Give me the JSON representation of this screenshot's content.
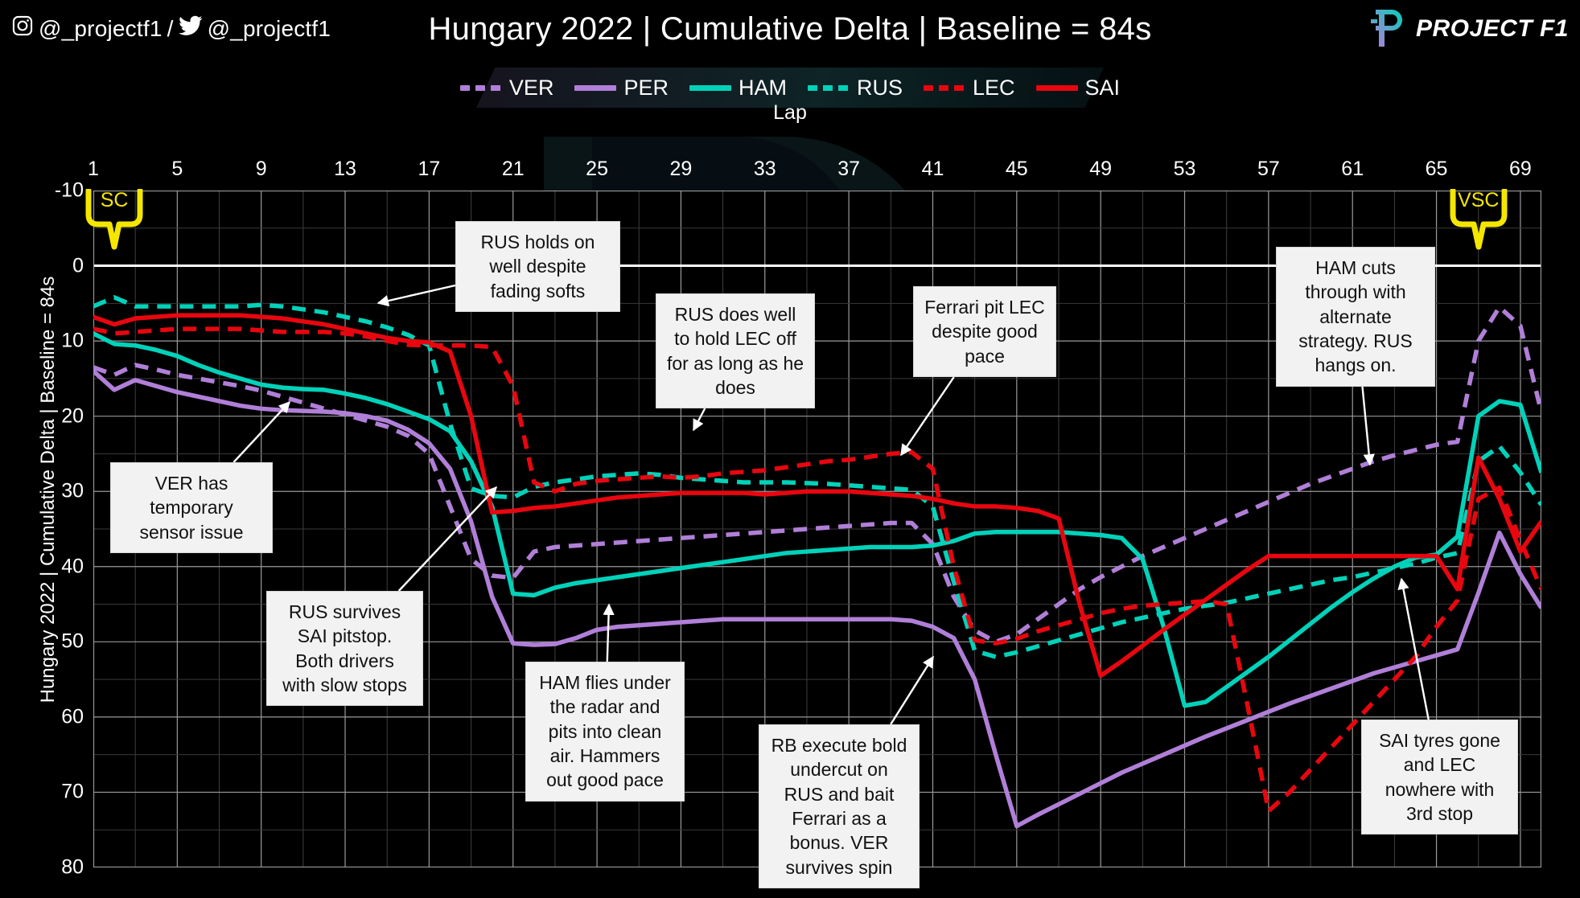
{
  "header": {
    "social_text": "@_projectf1 / @_projectf1",
    "instagram_handle": "@_projectf1",
    "twitter_handle": "@_projectf1",
    "title": "Hungary 2022 | Cumulative Delta | Baseline = 84s",
    "brand_name": "PROJECT F1",
    "instagram_icon": "instagram-icon",
    "twitter_icon": "twitter-icon",
    "logo_icon": "project-f1-logo-icon"
  },
  "chart_data": {
    "type": "line",
    "title": "Hungary 2022 | Cumulative Delta | Baseline = 84s",
    "xlabel": "Lap",
    "ylabel": "Hungary 2022 | Cumulative Delta | Baseline = 84s",
    "xlim": [
      1,
      70
    ],
    "ylim": [
      -10,
      80
    ],
    "y_inverted": true,
    "grid": true,
    "x_ticks": [
      1,
      5,
      9,
      13,
      17,
      21,
      25,
      29,
      33,
      37,
      41,
      45,
      49,
      53,
      57,
      61,
      65,
      69
    ],
    "y_ticks": [
      -10,
      0,
      10,
      20,
      30,
      40,
      50,
      60,
      70,
      80
    ],
    "legend_position": "top-center",
    "colors": {
      "VER": "#b07fd8",
      "PER": "#b07fd8",
      "HAM": "#00d2ba",
      "RUS": "#00d2ba",
      "LEC": "#e8060f",
      "SAI": "#e8060f",
      "background": "#000000",
      "text": "#ffffff",
      "grid": "#8a8a8a",
      "flag": "#f5e600",
      "annotation_bg": "#f2f2f2",
      "annotation_text": "#111111"
    },
    "series": [
      {
        "name": "VER",
        "style": "dashed",
        "color": "#b07fd8",
        "x": [
          1,
          2,
          3,
          4,
          5,
          6,
          7,
          8,
          9,
          10,
          11,
          12,
          13,
          14,
          15,
          16,
          17,
          18,
          19,
          20,
          21,
          22,
          23,
          24,
          25,
          26,
          27,
          28,
          29,
          30,
          31,
          32,
          33,
          34,
          35,
          36,
          37,
          38,
          39,
          40,
          41,
          42,
          43,
          44,
          45,
          46,
          47,
          48,
          49,
          50,
          51,
          52,
          53,
          54,
          55,
          56,
          57,
          58,
          59,
          60,
          61,
          62,
          63,
          64,
          65,
          66,
          67,
          68,
          69,
          70
        ],
        "values": [
          13.5,
          14.5,
          13.2,
          13.8,
          14.5,
          15.0,
          15.5,
          16.0,
          16.6,
          17.4,
          18.2,
          19.0,
          19.8,
          20.6,
          21.4,
          22.6,
          25.0,
          32.0,
          39.0,
          41.2,
          41.5,
          38.0,
          37.4,
          37.2,
          37.0,
          36.8,
          36.6,
          36.4,
          36.2,
          36.0,
          35.8,
          35.6,
          35.4,
          35.2,
          35.0,
          34.8,
          34.6,
          34.4,
          34.2,
          34.2,
          37.0,
          44.0,
          48.5,
          50.0,
          49.0,
          47.0,
          45.0,
          43.0,
          41.4,
          40.0,
          38.6,
          37.4,
          36.2,
          35.0,
          33.8,
          32.6,
          31.4,
          30.2,
          29.0,
          28.0,
          27.0,
          26.0,
          25.2,
          24.5,
          23.8,
          23.4,
          10.0,
          5.5,
          8.0,
          19.5
        ]
      },
      {
        "name": "PER",
        "style": "solid",
        "color": "#b07fd8",
        "x": [
          1,
          2,
          3,
          4,
          5,
          6,
          7,
          8,
          9,
          10,
          11,
          12,
          13,
          14,
          15,
          16,
          17,
          18,
          19,
          20,
          21,
          22,
          23,
          24,
          25,
          26,
          27,
          28,
          29,
          30,
          31,
          32,
          33,
          34,
          35,
          36,
          37,
          38,
          39,
          40,
          41,
          42,
          43,
          44,
          45,
          46,
          47,
          48,
          49,
          50,
          51,
          52,
          53,
          54,
          55,
          56,
          57,
          58,
          59,
          60,
          61,
          62,
          63,
          64,
          65,
          66,
          67,
          68,
          69,
          70
        ],
        "values": [
          14.0,
          16.5,
          15.2,
          16.0,
          16.8,
          17.4,
          18.0,
          18.6,
          19.0,
          19.2,
          19.3,
          19.4,
          19.6,
          20.0,
          20.6,
          21.8,
          23.6,
          27.0,
          34.0,
          44.0,
          50.2,
          50.4,
          50.3,
          49.5,
          48.4,
          48.0,
          47.8,
          47.6,
          47.4,
          47.2,
          47.0,
          47.0,
          47.0,
          47.0,
          47.0,
          47.0,
          47.0,
          47.0,
          47.0,
          47.2,
          48.0,
          49.5,
          55.0,
          65.0,
          74.5,
          73.0,
          71.6,
          70.2,
          68.8,
          67.4,
          66.2,
          65.0,
          63.8,
          62.6,
          61.5,
          60.4,
          59.3,
          58.2,
          57.2,
          56.2,
          55.2,
          54.2,
          53.4,
          52.6,
          51.8,
          51.0,
          43.5,
          35.5,
          41.0,
          45.5
        ]
      },
      {
        "name": "HAM",
        "style": "solid",
        "color": "#00d2ba",
        "x": [
          1,
          2,
          3,
          4,
          5,
          6,
          7,
          8,
          9,
          10,
          11,
          12,
          13,
          14,
          15,
          16,
          17,
          18,
          19,
          20,
          21,
          22,
          23,
          24,
          25,
          26,
          27,
          28,
          29,
          30,
          31,
          32,
          33,
          34,
          35,
          36,
          37,
          38,
          39,
          40,
          41,
          42,
          43,
          44,
          45,
          46,
          47,
          48,
          49,
          50,
          51,
          52,
          53,
          54,
          55,
          56,
          57,
          58,
          59,
          60,
          61,
          62,
          63,
          64,
          65,
          66,
          67,
          68,
          69,
          70
        ],
        "values": [
          9.0,
          10.4,
          10.6,
          11.2,
          12.0,
          13.2,
          14.2,
          15.0,
          15.8,
          16.2,
          16.4,
          16.5,
          17.0,
          17.6,
          18.4,
          19.4,
          20.4,
          22.0,
          26.0,
          32.0,
          43.6,
          43.8,
          42.8,
          42.2,
          41.8,
          41.4,
          41.0,
          40.6,
          40.2,
          39.8,
          39.4,
          39.0,
          38.6,
          38.2,
          38.0,
          37.8,
          37.6,
          37.4,
          37.4,
          37.4,
          37.2,
          36.6,
          35.6,
          35.4,
          35.4,
          35.4,
          35.4,
          35.6,
          35.8,
          36.2,
          39.0,
          48.0,
          58.5,
          58.0,
          56.0,
          54.0,
          52.0,
          49.8,
          47.6,
          45.4,
          43.4,
          41.6,
          40.0,
          38.8,
          38.4,
          36.0,
          20.0,
          18.0,
          18.5,
          27.5
        ]
      },
      {
        "name": "RUS",
        "style": "dashed",
        "color": "#00d2ba",
        "x": [
          1,
          2,
          3,
          4,
          5,
          6,
          7,
          8,
          9,
          10,
          11,
          12,
          13,
          14,
          15,
          16,
          17,
          18,
          19,
          20,
          21,
          22,
          23,
          24,
          25,
          26,
          27,
          28,
          29,
          30,
          31,
          32,
          33,
          34,
          35,
          36,
          37,
          38,
          39,
          40,
          41,
          42,
          43,
          44,
          45,
          46,
          47,
          48,
          49,
          50,
          51,
          52,
          53,
          54,
          55,
          56,
          57,
          58,
          59,
          60,
          61,
          62,
          63,
          64,
          65,
          66,
          67,
          68,
          69,
          70
        ],
        "values": [
          5.4,
          4.2,
          5.4,
          5.4,
          5.4,
          5.4,
          5.4,
          5.4,
          5.2,
          5.4,
          5.8,
          6.2,
          6.8,
          7.4,
          8.2,
          9.2,
          10.6,
          21.0,
          29.6,
          30.6,
          30.8,
          29.4,
          28.8,
          28.4,
          28.0,
          27.8,
          27.6,
          27.8,
          28.2,
          28.4,
          28.6,
          28.8,
          28.8,
          28.8,
          28.9,
          29.0,
          29.2,
          29.4,
          29.6,
          29.8,
          32.0,
          42.0,
          51.2,
          52.0,
          51.4,
          50.6,
          49.8,
          49.0,
          48.2,
          47.4,
          46.8,
          46.2,
          45.6,
          45.2,
          44.8,
          44.2,
          43.6,
          43.0,
          42.4,
          41.8,
          41.4,
          40.8,
          40.2,
          39.6,
          38.8,
          38.2,
          26.0,
          24.0,
          27.5,
          31.8
        ]
      },
      {
        "name": "LEC",
        "style": "dashed",
        "color": "#e8060f",
        "x": [
          1,
          2,
          3,
          4,
          5,
          6,
          7,
          8,
          9,
          10,
          11,
          12,
          13,
          14,
          15,
          16,
          17,
          18,
          19,
          20,
          21,
          22,
          23,
          24,
          25,
          26,
          27,
          28,
          29,
          30,
          31,
          32,
          33,
          34,
          35,
          36,
          37,
          38,
          39,
          40,
          41,
          42,
          43,
          44,
          45,
          46,
          47,
          48,
          49,
          50,
          51,
          52,
          53,
          54,
          55,
          56,
          57,
          58,
          59,
          60,
          61,
          62,
          63,
          64,
          65,
          66,
          67,
          68,
          69,
          70
        ],
        "values": [
          8.4,
          9.0,
          8.8,
          8.6,
          8.4,
          8.4,
          8.4,
          8.4,
          8.6,
          8.8,
          8.8,
          8.8,
          9.0,
          9.4,
          10.0,
          10.5,
          10.6,
          10.6,
          10.6,
          10.8,
          16.0,
          28.8,
          30.0,
          29.0,
          28.6,
          28.4,
          28.2,
          28.0,
          28.2,
          28.0,
          27.6,
          27.4,
          27.2,
          26.8,
          26.4,
          26.0,
          25.8,
          25.4,
          25.0,
          24.8,
          27.0,
          40.0,
          49.8,
          50.2,
          49.6,
          48.6,
          47.8,
          47.0,
          46.2,
          45.6,
          45.2,
          45.0,
          44.8,
          44.6,
          45.0,
          58.5,
          72.5,
          70.0,
          67.0,
          64.0,
          61.0,
          58.0,
          55.0,
          52.0,
          48.0,
          44.5,
          31.0,
          29.5,
          36.5,
          43.0
        ]
      },
      {
        "name": "SAI",
        "style": "solid",
        "color": "#e8060f",
        "x": [
          1,
          2,
          3,
          4,
          5,
          6,
          7,
          8,
          9,
          10,
          11,
          12,
          13,
          14,
          15,
          16,
          17,
          18,
          19,
          20,
          21,
          22,
          23,
          24,
          25,
          26,
          27,
          28,
          29,
          30,
          31,
          32,
          33,
          34,
          35,
          36,
          37,
          38,
          39,
          40,
          41,
          42,
          43,
          44,
          45,
          46,
          47,
          48,
          49,
          50,
          51,
          52,
          53,
          54,
          55,
          56,
          57,
          58,
          59,
          60,
          61,
          62,
          63,
          64,
          65,
          66,
          67,
          68,
          69,
          70
        ],
        "values": [
          6.8,
          7.8,
          7.0,
          6.8,
          6.6,
          6.6,
          6.6,
          6.6,
          6.8,
          7.0,
          7.4,
          7.8,
          8.4,
          9.0,
          9.6,
          10.0,
          10.2,
          11.4,
          20.0,
          32.8,
          32.6,
          32.2,
          32.0,
          31.6,
          31.2,
          30.8,
          30.6,
          30.4,
          30.2,
          30.2,
          30.2,
          30.2,
          30.4,
          30.2,
          30.0,
          30.0,
          30.0,
          30.2,
          30.4,
          30.6,
          31.0,
          31.6,
          32.0,
          32.0,
          32.2,
          32.6,
          33.6,
          45.0,
          54.5,
          52.6,
          50.5,
          48.4,
          46.4,
          44.4,
          42.4,
          40.4,
          38.6,
          38.6,
          38.6,
          38.6,
          38.6,
          38.6,
          38.6,
          38.6,
          38.6,
          43.0,
          25.5,
          31.0,
          38.0,
          34.0
        ]
      }
    ],
    "flags": [
      {
        "label": "SC",
        "lap": 2
      },
      {
        "label": "VSC",
        "lap": 67
      }
    ],
    "annotations": [
      {
        "id": "rus-holds-on",
        "text": "RUS holds on well despite fading softs"
      },
      {
        "id": "rus-does-well",
        "text": "RUS does well to hold LEC off for as long as he does"
      },
      {
        "id": "ferrari-pit-lec",
        "text": "Ferrari pit LEC despite good pace"
      },
      {
        "id": "ham-cuts-through",
        "text": "HAM cuts through with alternate strategy. RUS hangs on."
      },
      {
        "id": "ver-sensor",
        "text": "VER has temporary sensor issue"
      },
      {
        "id": "rus-survives-sai",
        "text": "RUS survives SAI pitstop. Both drivers with slow stops"
      },
      {
        "id": "ham-flies",
        "text": "HAM flies under the radar and pits into clean air. Hammers out good pace"
      },
      {
        "id": "rb-undercut",
        "text": "RB execute bold undercut on RUS and bait Ferrari as a bonus. VER survives spin"
      },
      {
        "id": "sai-tyres",
        "text": "SAI tyres gone and LEC nowhere with 3rd stop"
      }
    ]
  }
}
